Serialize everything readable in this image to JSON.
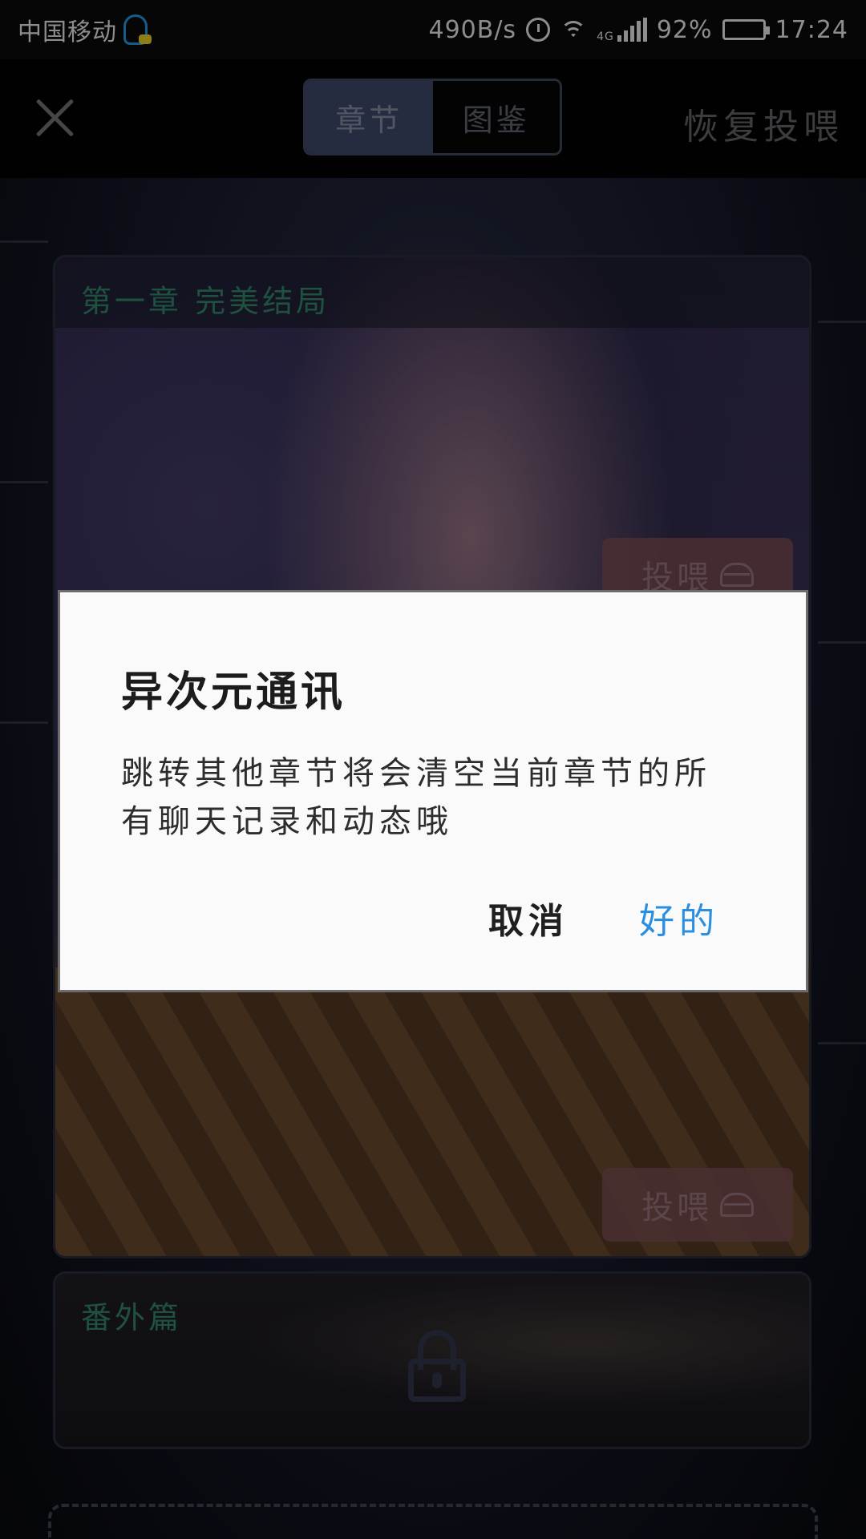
{
  "status_bar": {
    "carrier": "中国移动",
    "net_speed": "490B/s",
    "network_type": "4G",
    "battery_percent": "92%",
    "battery_level": 0.92,
    "time": "17:24"
  },
  "top_bar": {
    "tabs": [
      {
        "label": "章节",
        "active": true
      },
      {
        "label": "图鉴",
        "active": false
      }
    ],
    "restore_label": "恢复投喂"
  },
  "chapters": [
    {
      "title": "第一章  完美结局",
      "feed_labels": [
        "投喂",
        "投喂"
      ]
    },
    {
      "title": "番外篇",
      "locked": true
    }
  ],
  "dialog": {
    "title": "异次元通讯",
    "message": "跳转其他章节将会清空当前章节的所有聊天记录和动态哦",
    "cancel_label": "取消",
    "confirm_label": "好的"
  },
  "colors": {
    "confirm_accent": "#2a8fe0",
    "chapter_title": "#2f7d63",
    "tab_active_bg": "#3a4461"
  }
}
